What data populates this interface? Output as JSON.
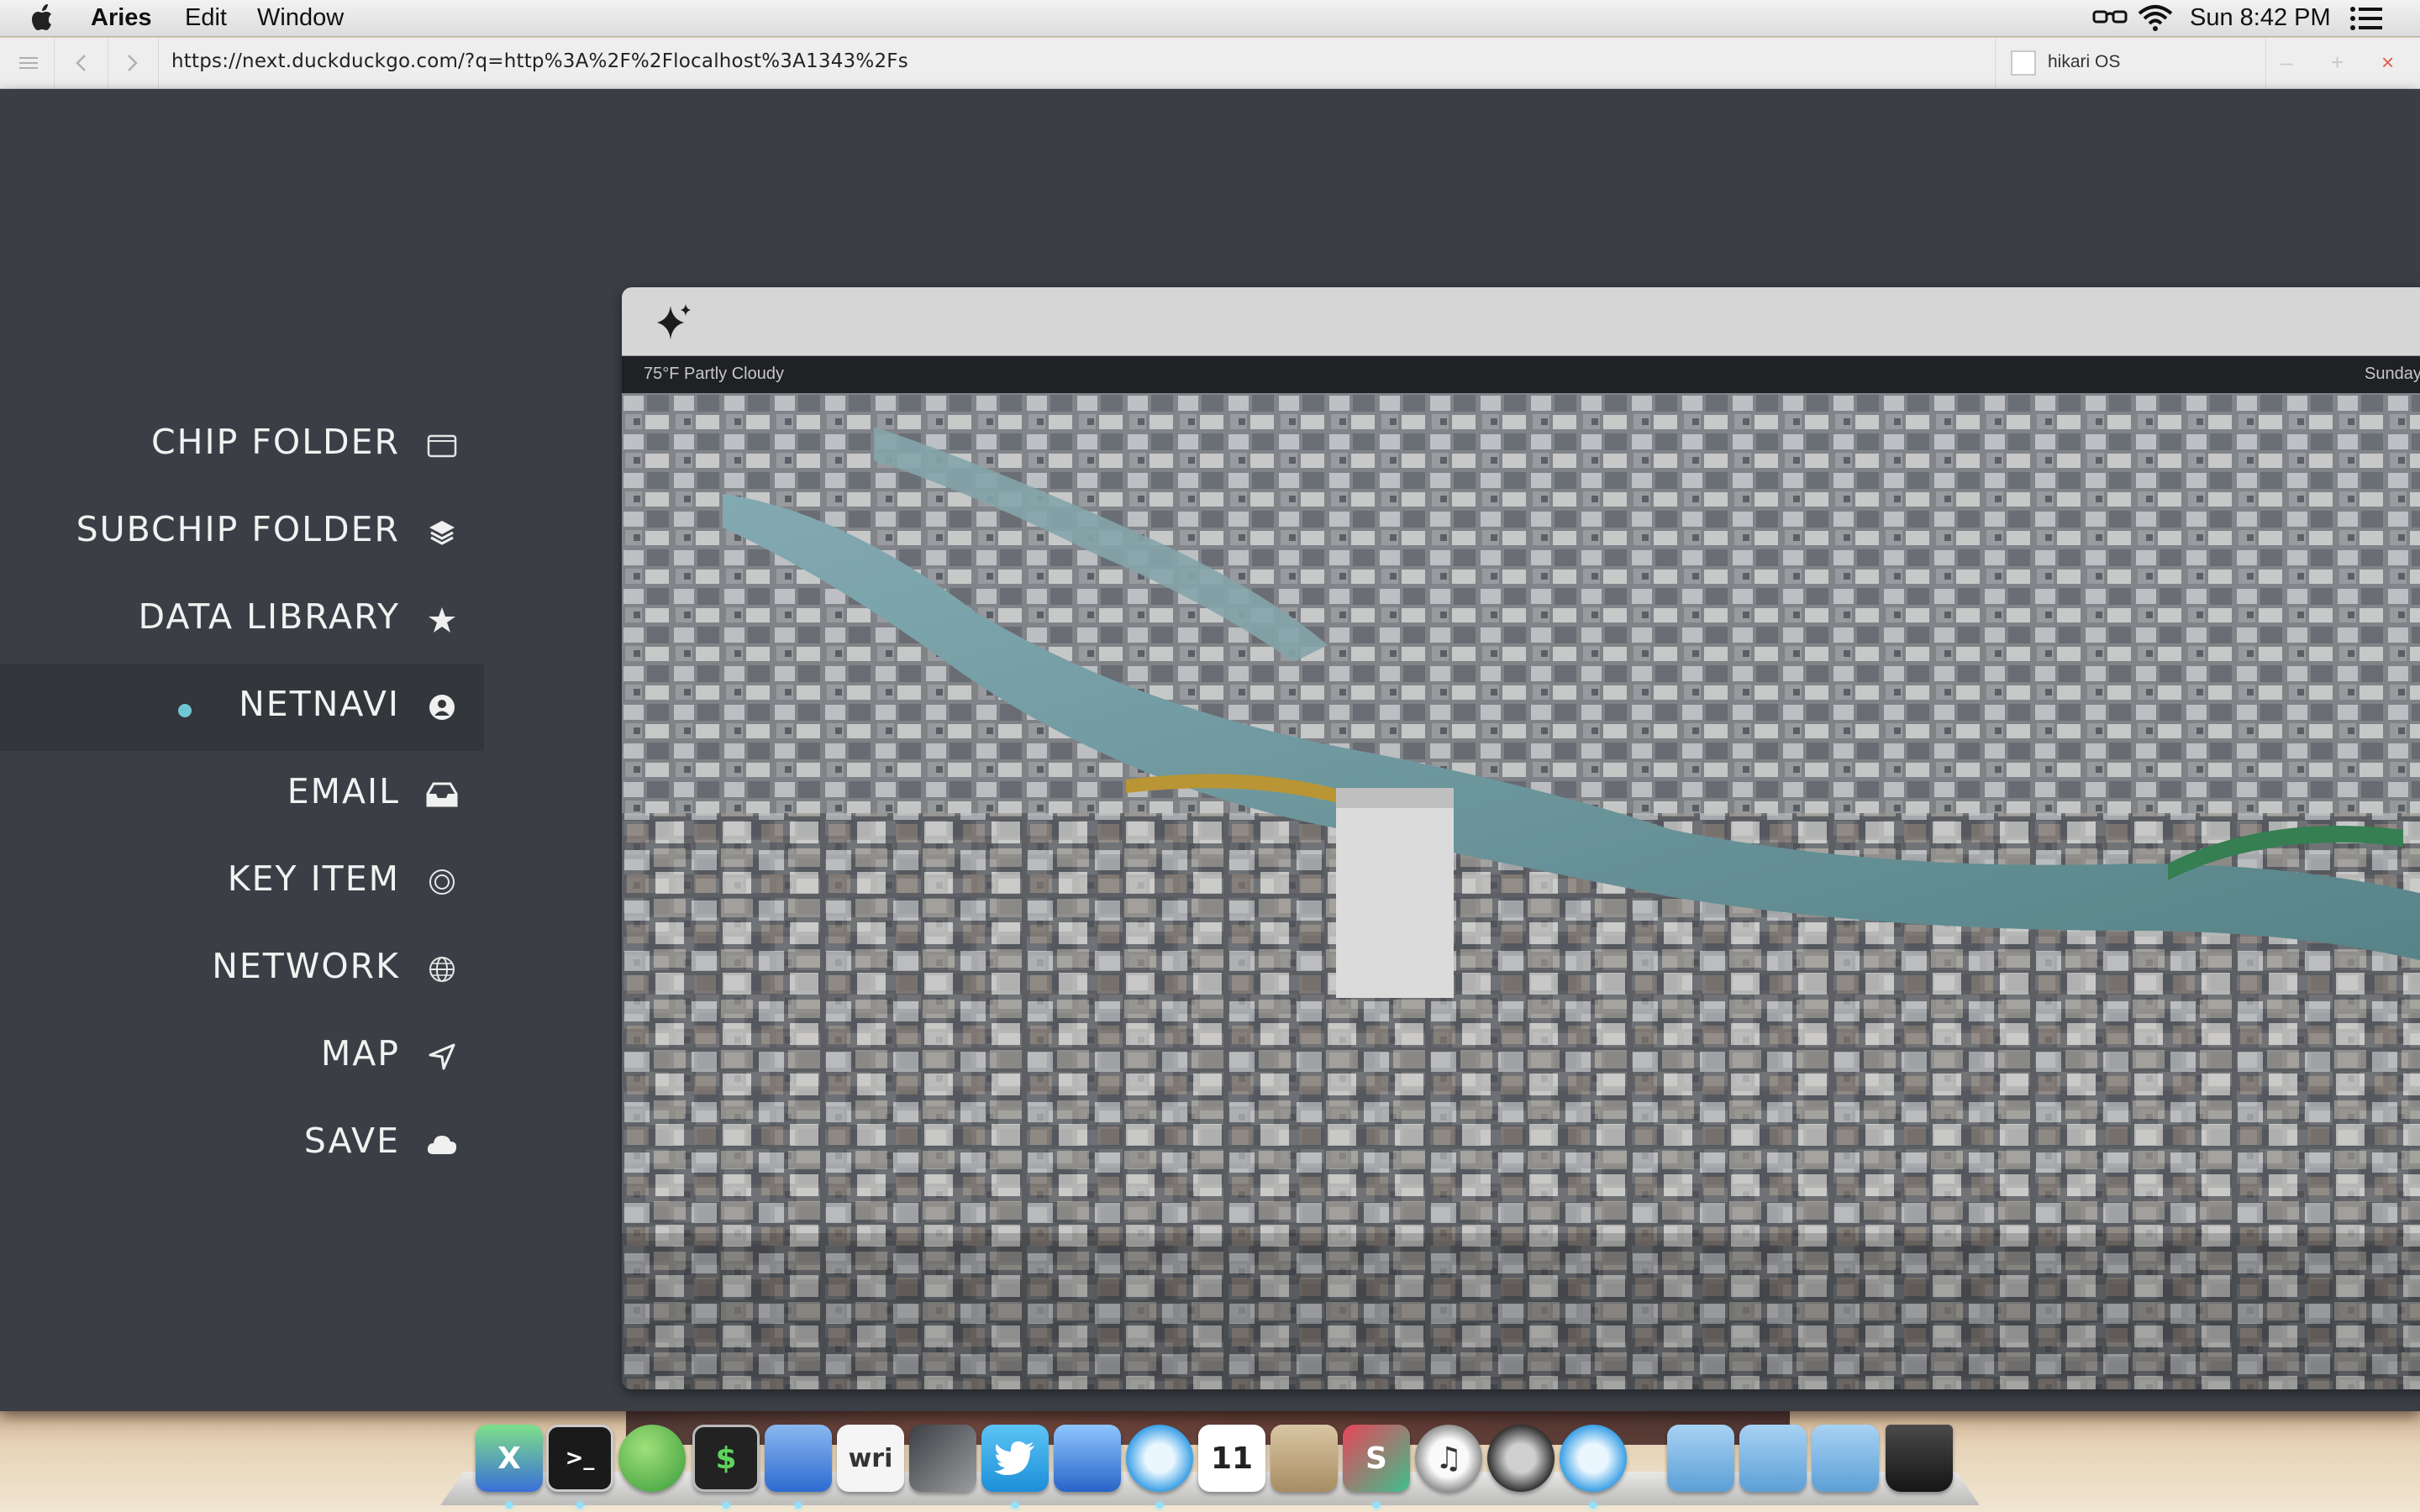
{
  "menubar": {
    "app_name": "Aries",
    "menus": [
      "Edit",
      "Window"
    ],
    "clock": "Sun 8:42 PM"
  },
  "browser": {
    "url": "https://next.duckduckgo.com/?q=http%3A%2F%2Flocalhost%3A1343%2Fs",
    "tab_title": "hikari OS"
  },
  "sidebar": {
    "items": [
      {
        "label": "CHIP FOLDER",
        "icon": "folder-icon"
      },
      {
        "label": "SUBCHIP FOLDER",
        "icon": "layers-icon"
      },
      {
        "label": "DATA LIBRARY",
        "icon": "star-icon"
      },
      {
        "label": "NETNAVI",
        "icon": "user-icon",
        "active": true
      },
      {
        "label": "EMAIL",
        "icon": "inbox-icon"
      },
      {
        "label": "KEY ITEM",
        "icon": "target-icon"
      },
      {
        "label": "NETWORK",
        "icon": "globe-icon"
      },
      {
        "label": "MAP",
        "icon": "navigation-icon"
      },
      {
        "label": "SAVE",
        "icon": "cloud-icon"
      }
    ],
    "active_dot_color": "#6ec7d3"
  },
  "panel": {
    "weather": "75°F Partly Cloudy",
    "day": "Sunday"
  },
  "dock": {
    "apps": [
      {
        "name": "x-app-icon",
        "glyph": "X"
      },
      {
        "name": "terminal-icon",
        "glyph": ">_"
      },
      {
        "name": "leaf-app-icon",
        "glyph": ""
      },
      {
        "name": "console-icon",
        "glyph": "$"
      },
      {
        "name": "xcode-icon",
        "glyph": ""
      },
      {
        "name": "writer-app-icon",
        "glyph": "wri"
      },
      {
        "name": "sketch-app-icon",
        "glyph": ""
      },
      {
        "name": "twitter-icon",
        "glyph": ""
      },
      {
        "name": "pixelmator-icon",
        "glyph": ""
      },
      {
        "name": "safari-icon",
        "glyph": ""
      },
      {
        "name": "calendar-icon",
        "glyph": "11"
      },
      {
        "name": "mail-stamp-icon",
        "glyph": ""
      },
      {
        "name": "slack-icon",
        "glyph": "S"
      },
      {
        "name": "itunes-icon",
        "glyph": "♫"
      },
      {
        "name": "tweetbot-icon",
        "glyph": ""
      },
      {
        "name": "safari-icon-2",
        "glyph": ""
      },
      {
        "name": "downloads-folder-icon",
        "glyph": ""
      },
      {
        "name": "applications-folder-icon",
        "glyph": ""
      },
      {
        "name": "pictures-folder-icon",
        "glyph": ""
      },
      {
        "name": "trash-icon",
        "glyph": ""
      }
    ]
  }
}
